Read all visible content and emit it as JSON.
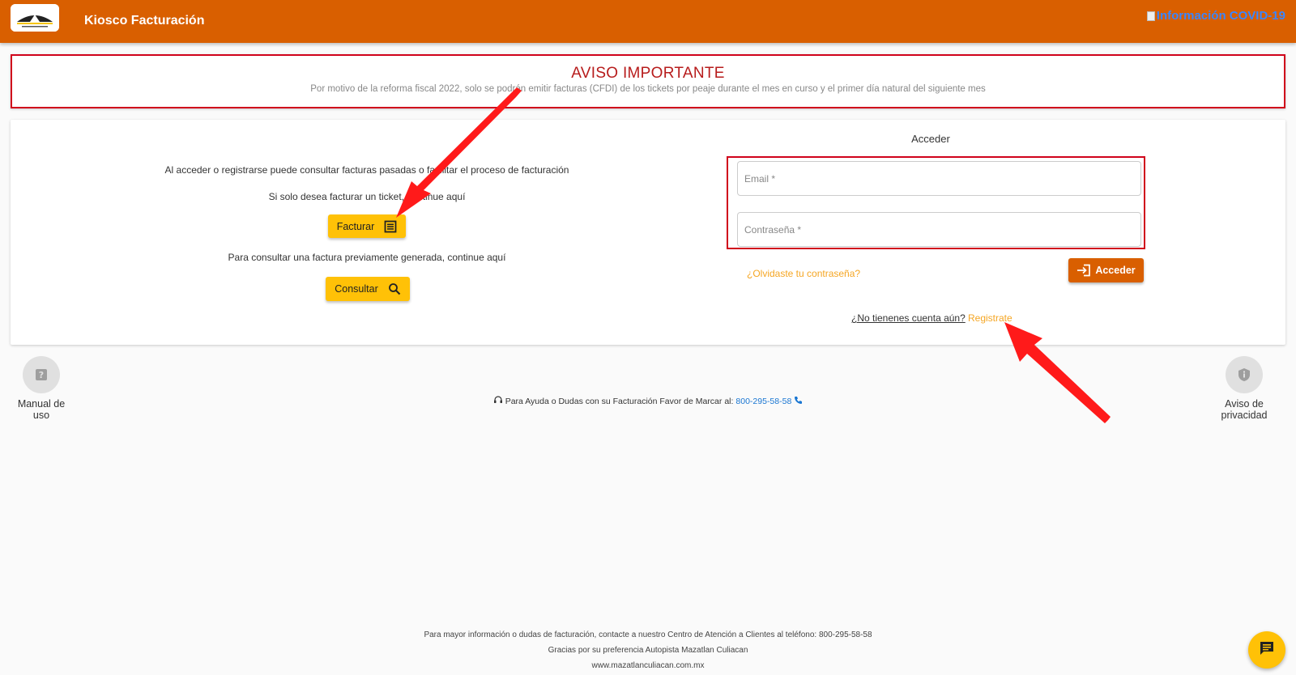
{
  "header": {
    "app_title": "Kiosco Facturación",
    "covid_link": "Información COVID-19",
    "brand_color": "#d95f00"
  },
  "notice": {
    "title": "AVISO IMPORTANTE",
    "body": "Por motivo de la reforma fiscal 2022, solo se podrán emitir facturas (CFDI) de los tickets por peaje durante el mes en curso y el primer día natural del siguiente mes"
  },
  "left": {
    "intro": "Al acceder o registrarse puede consultar facturas pasadas o facilitar el proceso de facturación",
    "ticket_text": "Si solo desea facturar un ticket, continue aquí",
    "facturar_label": "Facturar",
    "consult_text": "Para consultar una factura previamente generada, continue aquí",
    "consultar_label": "Consultar"
  },
  "login": {
    "title": "Acceder",
    "email_placeholder": "Email *",
    "email_value": "",
    "password_placeholder": "Contraseña *",
    "password_value": "",
    "forgot_label": "¿Olvidaste tu contraseña?",
    "acceder_label": "Acceder",
    "no_account_label": "¿No tienenes cuenta aún?",
    "register_label": "Registrate"
  },
  "side": {
    "manual_label": "Manual de uso",
    "privacy_label": "Aviso de privacidad"
  },
  "help": {
    "text": "Para Ayuda o Dudas con su Facturación Favor de Marcar al:",
    "phone": "800-295-58-58"
  },
  "footer": {
    "line1": "Para mayor información o dudas de facturación, contacte a nuestro Centro de Atención a Clientes al teléfono: 800-295-58-58",
    "line2": "Gracias por su preferencia Autopista Mazatlan Culiacan",
    "line3": "www.mazatlanculiacan.com.mx"
  },
  "colors": {
    "accent_yellow": "#ffc107",
    "alert_red": "#d0021b",
    "link_orange": "#f5a623",
    "annotation_arrow": "#ff1a1a"
  },
  "icons": [
    "logo-image",
    "receipt-icon",
    "search-icon",
    "login-icon",
    "help-icon",
    "shield-icon",
    "headset-icon",
    "phone-icon",
    "chat-icon"
  ]
}
